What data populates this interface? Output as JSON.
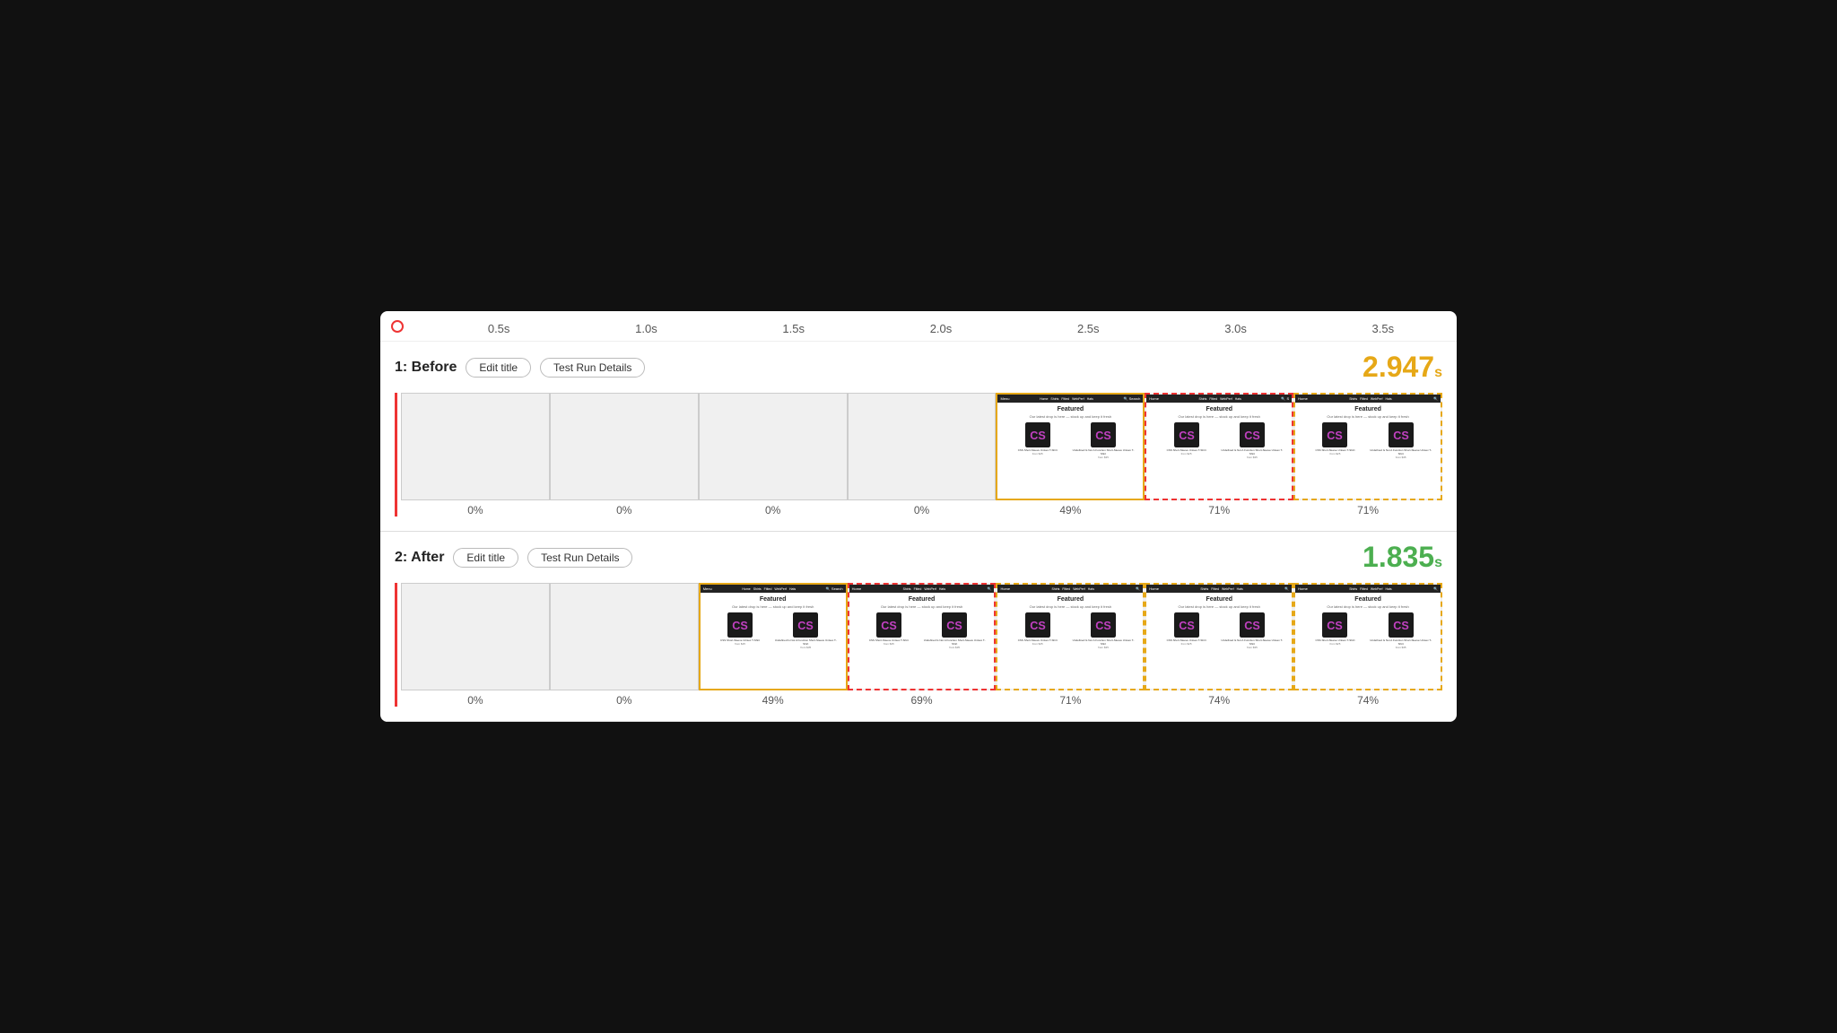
{
  "timeline": {
    "ticks": [
      "0.5s",
      "1.0s",
      "1.5s",
      "2.0s",
      "2.5s",
      "3.0s",
      "3.5s"
    ]
  },
  "sections": [
    {
      "id": "before",
      "label": "1: Before",
      "edit_title_label": "Edit title",
      "test_run_label": "Test Run Details",
      "metric": "2.947",
      "metric_unit": "s",
      "metric_color": "before",
      "frames": [
        {
          "pct": "0%",
          "has_content": false,
          "border": "normal"
        },
        {
          "pct": "0%",
          "has_content": false,
          "border": "normal"
        },
        {
          "pct": "0%",
          "has_content": false,
          "border": "normal"
        },
        {
          "pct": "0%",
          "has_content": false,
          "border": "normal"
        },
        {
          "pct": "49%",
          "has_content": true,
          "border": "yellow",
          "nav_items": [
            "Menu",
            "Home",
            "Shirts",
            "Fitted",
            "WebPerf",
            "Hats"
          ],
          "search": "Search"
        },
        {
          "pct": "71%",
          "has_content": true,
          "border": "red-dashed",
          "nav_items": [
            "Home",
            "Shirts",
            "Fitted",
            "WebPerf",
            "Hats"
          ],
          "search": "S"
        },
        {
          "pct": "71%",
          "has_content": true,
          "border": "yellow-dashed",
          "nav_items": [
            "Home",
            "Shirts",
            "Fitted",
            "WebPerf",
            "Hats"
          ]
        }
      ]
    },
    {
      "id": "after",
      "label": "2: After",
      "edit_title_label": "Edit title",
      "test_run_label": "Test Run Details",
      "metric": "1.835",
      "metric_unit": "s",
      "metric_color": "after",
      "frames": [
        {
          "pct": "0%",
          "has_content": false,
          "border": "normal"
        },
        {
          "pct": "0%",
          "has_content": false,
          "border": "normal"
        },
        {
          "pct": "49%",
          "has_content": true,
          "border": "yellow",
          "nav_items": [
            "Menu",
            "Home",
            "Shirts",
            "Fitted",
            "WebPerf",
            "Hats"
          ],
          "search": "Search"
        },
        {
          "pct": "69%",
          "has_content": true,
          "border": "red-dashed",
          "nav_items": [
            "Home",
            "Shirts",
            "Fitted",
            "WebPerf",
            "Hats"
          ]
        },
        {
          "pct": "71%",
          "has_content": true,
          "border": "yellow-dashed",
          "nav_items": [
            "Home",
            "Shirts",
            "Fitted",
            "WebPerf",
            "Hats"
          ]
        },
        {
          "pct": "74%",
          "has_content": true,
          "border": "yellow-dashed",
          "nav_items": [
            "Home",
            "Shirts",
            "Fitted",
            "WebPerf",
            "Hats"
          ]
        },
        {
          "pct": "74%",
          "has_content": true,
          "border": "yellow-dashed",
          "nav_items": [
            "Home",
            "Shirts",
            "Fitted",
            "WebPerf",
            "Hats"
          ]
        }
      ]
    }
  ]
}
